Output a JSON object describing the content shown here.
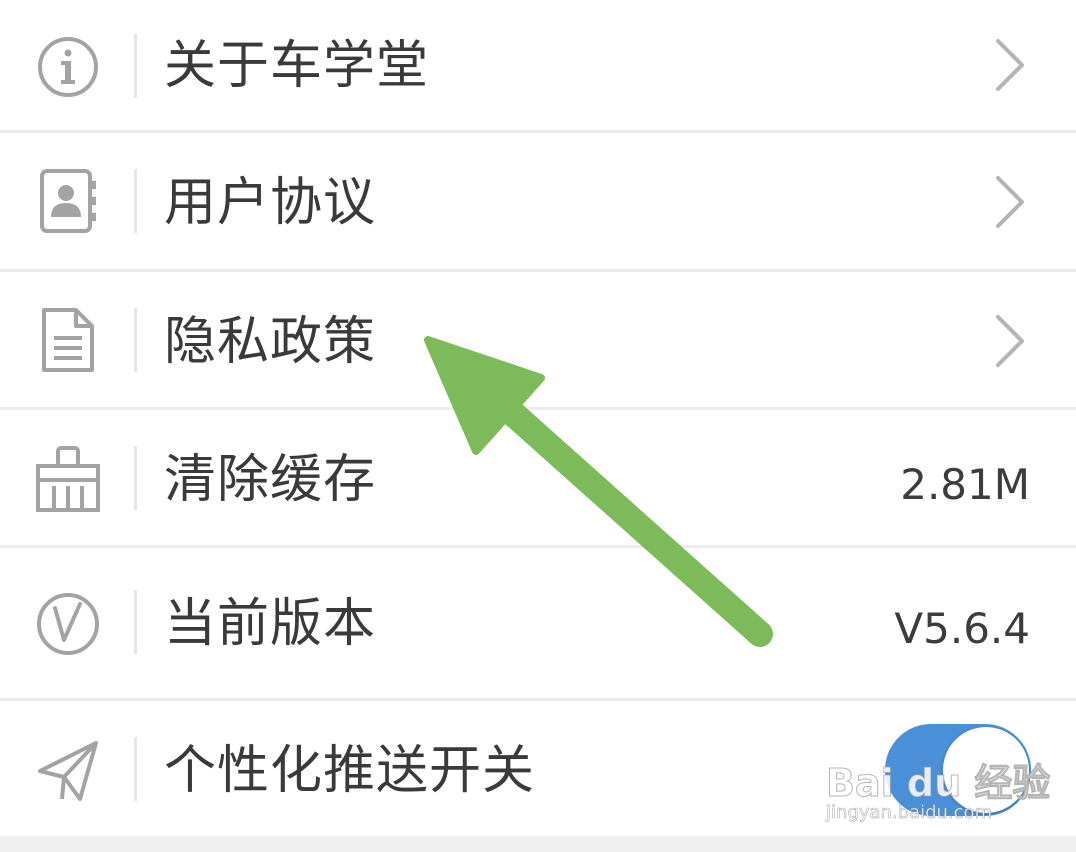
{
  "settings": {
    "items": [
      {
        "label": "关于车学堂",
        "icon": "info-icon",
        "accessory": "chevron"
      },
      {
        "label": "用户协议",
        "icon": "contact-book-icon",
        "accessory": "chevron"
      },
      {
        "label": "隐私政策",
        "icon": "document-icon",
        "accessory": "chevron"
      },
      {
        "label": "清除缓存",
        "icon": "broom-icon",
        "value": "2.81M"
      },
      {
        "label": "当前版本",
        "icon": "version-icon",
        "value": "V5.6.4"
      },
      {
        "label": "个性化推送开关",
        "icon": "paper-plane-icon",
        "toggle": true
      }
    ]
  },
  "annotation": {
    "arrow_color": "#7dbb5a",
    "points_to": "隐私政策"
  },
  "watermark": {
    "brand": "Bai du 经验",
    "url": "jingyan.baidu.com"
  },
  "colors": {
    "toggle_on": "#4a90d9",
    "icon_gray": "#a3a3a3"
  }
}
